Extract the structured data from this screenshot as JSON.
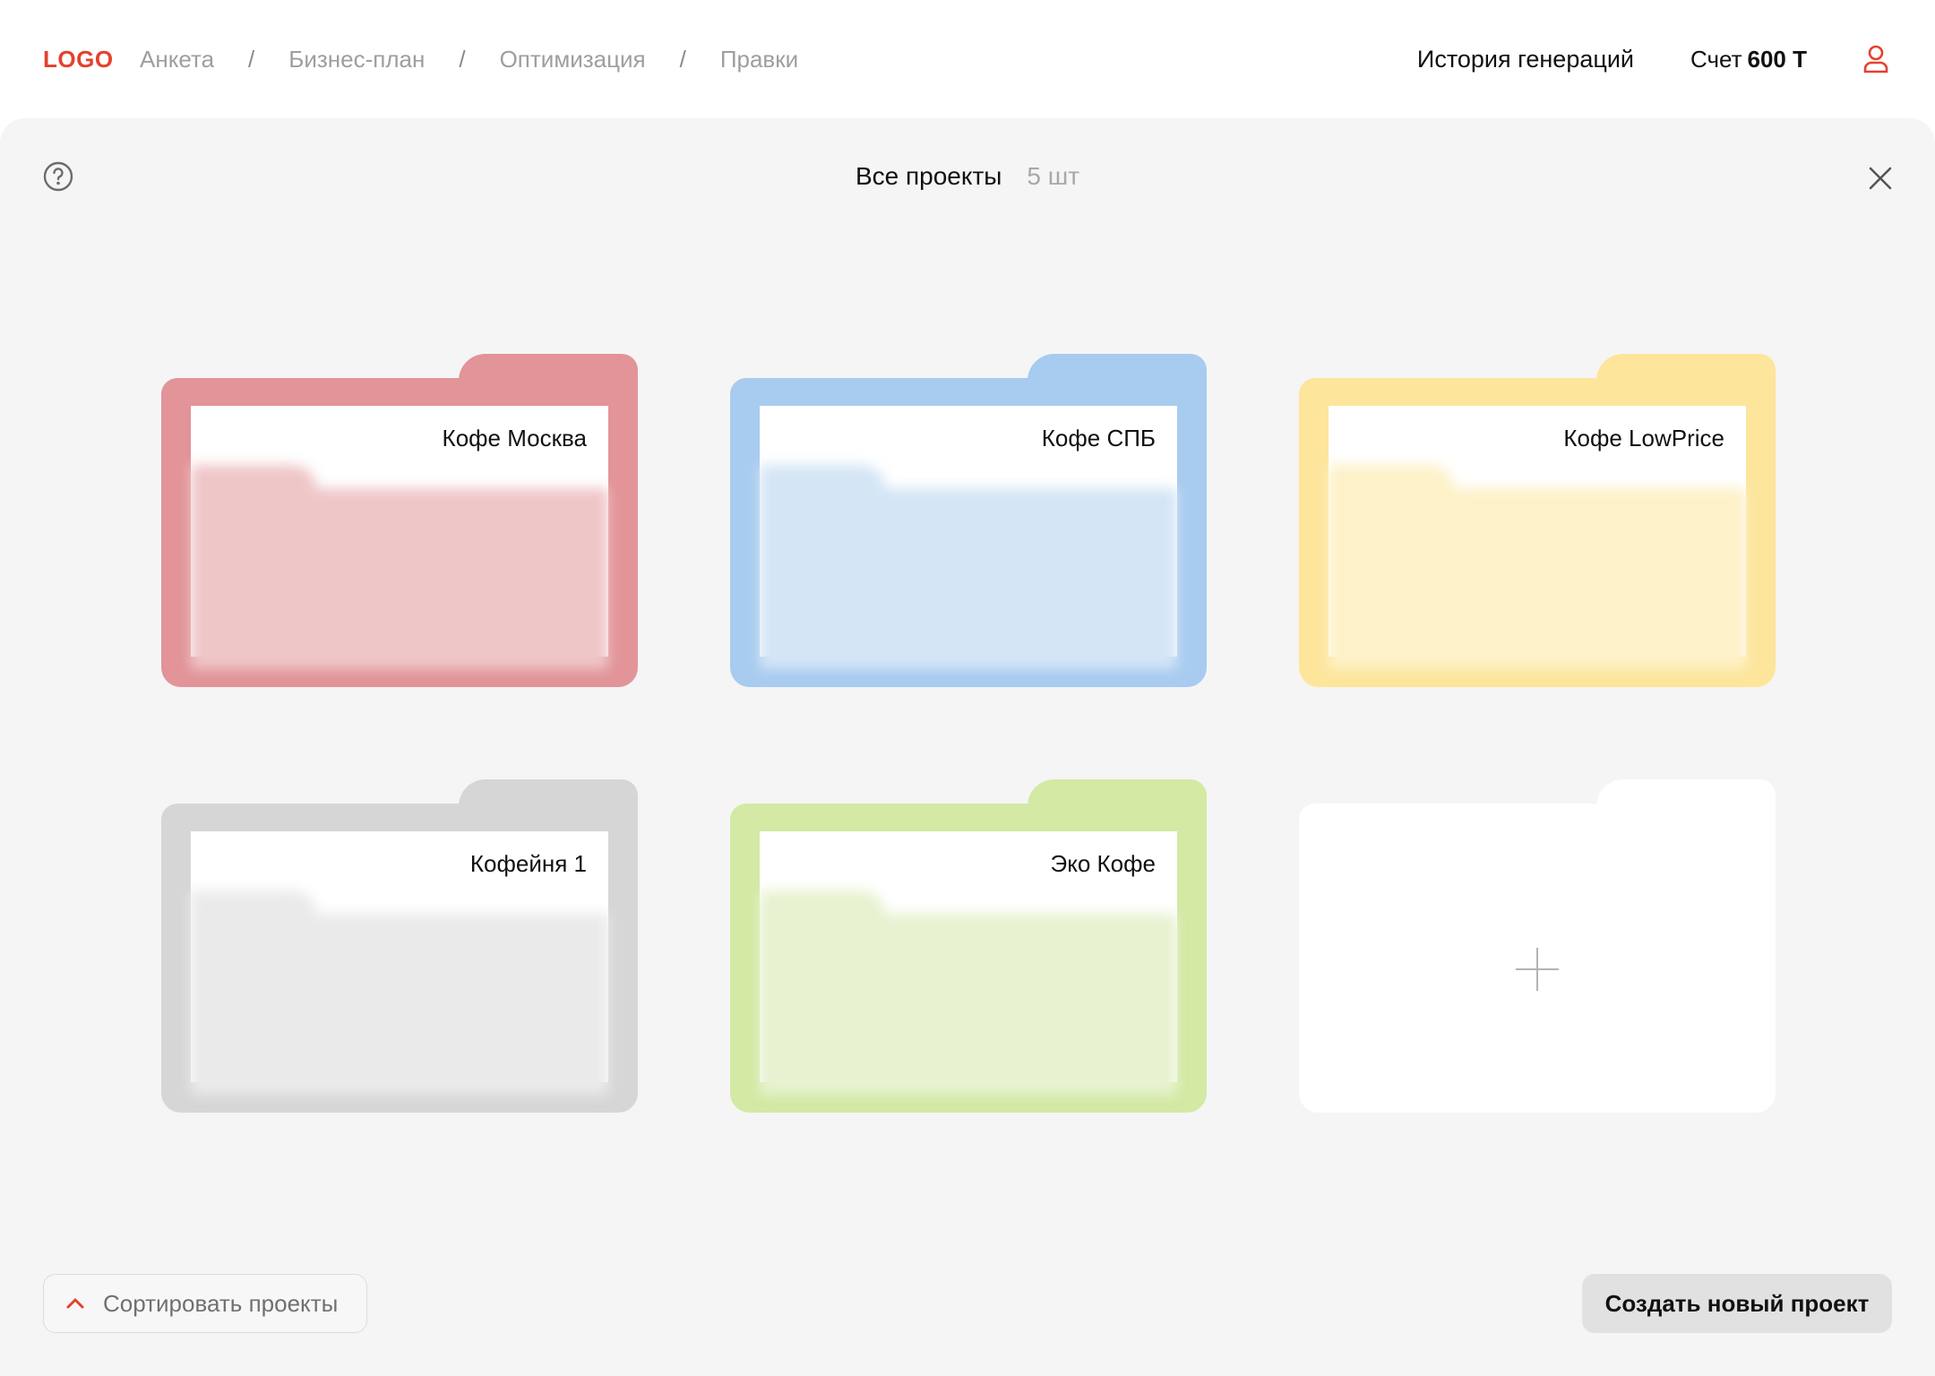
{
  "brand": {
    "logo": "LOGO",
    "accent_color": "#e5402d"
  },
  "breadcrumb": {
    "items": [
      "Анкета",
      "Бизнес-план",
      "Оптимизация",
      "Правки"
    ],
    "separator": "/"
  },
  "header": {
    "history_label": "История генераций",
    "balance_label": "Счет",
    "balance_amount": "600 Т",
    "user_icon": "user-icon"
  },
  "panel": {
    "title": "Все проекты",
    "count": "5 шт",
    "help_icon": "question-circle-icon",
    "close_icon": "close-icon"
  },
  "projects": [
    {
      "name": "Кофе Москва",
      "color": "#e29498",
      "pocket_color": "#efc6c8"
    },
    {
      "name": "Кофе СПБ",
      "color": "#a8cbf0",
      "pocket_color": "#d4e5f5"
    },
    {
      "name": "Кофе LowPrice",
      "color": "#fde59b",
      "pocket_color": "#fdf1c8"
    },
    {
      "name": "Кофейня 1",
      "color": "#d6d6d6",
      "pocket_color": "#eaeaea"
    },
    {
      "name": "Эко Кофе",
      "color": "#d3e9a4",
      "pocket_color": "#e7f2d0"
    }
  ],
  "new_project_tile": {
    "icon": "plus-icon"
  },
  "footer": {
    "sort_label": "Сортировать проекты",
    "sort_icon": "chevron-up-icon",
    "create_label": "Создать новый проект"
  }
}
